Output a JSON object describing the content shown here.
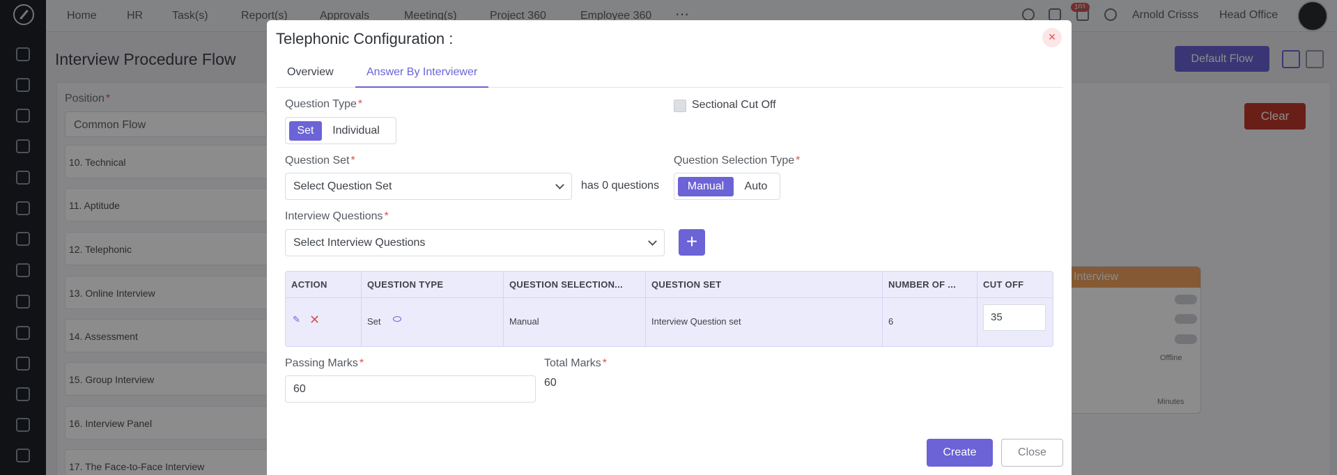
{
  "nav": {
    "items": [
      "Home",
      "HR",
      "Task(s)",
      "Report(s)",
      "Approvals",
      "Meeting(s)",
      "Project 360",
      "Employee 360"
    ],
    "more_icon": "ellipsis-icon",
    "notification_count": "101",
    "user_name": "Arnold Crisss",
    "location": "Head Office"
  },
  "background": {
    "page_title": "Interview Procedure Flow",
    "default_flow_label": "Default Flow",
    "position_label": "Position",
    "position_value": "Common Flow",
    "steps": [
      "10. Technical",
      "11. Aptitude",
      "12. Telephonic",
      "13. Online Interview",
      "14. Assessment",
      "15. Group Interview",
      "16. Interview Panel",
      "17. The Face-to-Face Interview"
    ],
    "clear_label": "Clear",
    "node_title": "Interview",
    "node_offline": "Offline",
    "node_minutes": "Minutes"
  },
  "modal": {
    "title": "Telephonic Configuration :",
    "close_glyph": "×",
    "tabs": [
      {
        "label": "Overview",
        "active": false
      },
      {
        "label": "Answer By Interviewer",
        "active": true
      }
    ],
    "question_type": {
      "label": "Question Type",
      "options": [
        "Set",
        "Individual"
      ],
      "selected": "Set"
    },
    "sectional_cut_off": {
      "label": "Sectional Cut Off",
      "checked": false
    },
    "question_set": {
      "label": "Question Set",
      "placeholder": "Select Question Set",
      "count_text": "has 0 questions"
    },
    "selection_type": {
      "label": "Question Selection Type",
      "options": [
        "Manual",
        "Auto"
      ],
      "selected": "Manual"
    },
    "interview_questions": {
      "label": "Interview Questions",
      "placeholder": "Select Interview Questions",
      "add_glyph": "+"
    },
    "table": {
      "headers": [
        "ACTION",
        "QUESTION TYPE",
        "QUESTION SELECTION...",
        "QUESTION SET",
        "NUMBER OF ...",
        "CUT OFF"
      ],
      "rows": [
        {
          "question_type": "Set",
          "selection": "Manual",
          "question_set": "Interview Question set",
          "number": "6",
          "cut_off": "35"
        }
      ]
    },
    "passing_marks": {
      "label": "Passing Marks",
      "value": "60"
    },
    "total_marks": {
      "label": "Total Marks",
      "value": "60"
    },
    "create_label": "Create",
    "close_label": "Close"
  },
  "colors": {
    "accent": "#6b63d6",
    "danger": "#d9534f",
    "rail": "#1e2229"
  }
}
